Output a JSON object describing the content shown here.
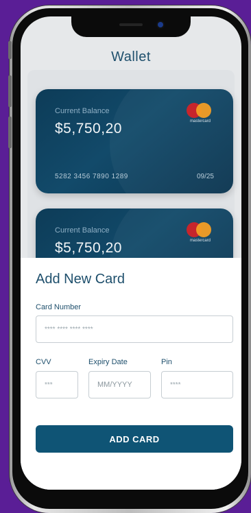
{
  "header": {
    "title": "Wallet"
  },
  "cards": [
    {
      "balance_label": "Current Balance",
      "balance": "$5,750,20",
      "number": "5282 3456 7890 1289",
      "expiry": "09/25",
      "brand": "mastercard"
    },
    {
      "balance_label": "Current Balance",
      "balance": "$5,750,20",
      "brand": "mastercard"
    }
  ],
  "form": {
    "title": "Add New Card",
    "card_number_label": "Card Number",
    "card_number_placeholder": "**** **** **** ****",
    "cvv_label": "CVV",
    "cvv_placeholder": "***",
    "expiry_label": "Expiry Date",
    "expiry_placeholder": "MM/YYYY",
    "pin_label": "Pin",
    "pin_placeholder": "****",
    "submit_label": "ADD CARD"
  },
  "colors": {
    "background": "#5a1e96",
    "card": "#0d3c58",
    "primary": "#0f5475",
    "title": "#1e4f6c"
  }
}
